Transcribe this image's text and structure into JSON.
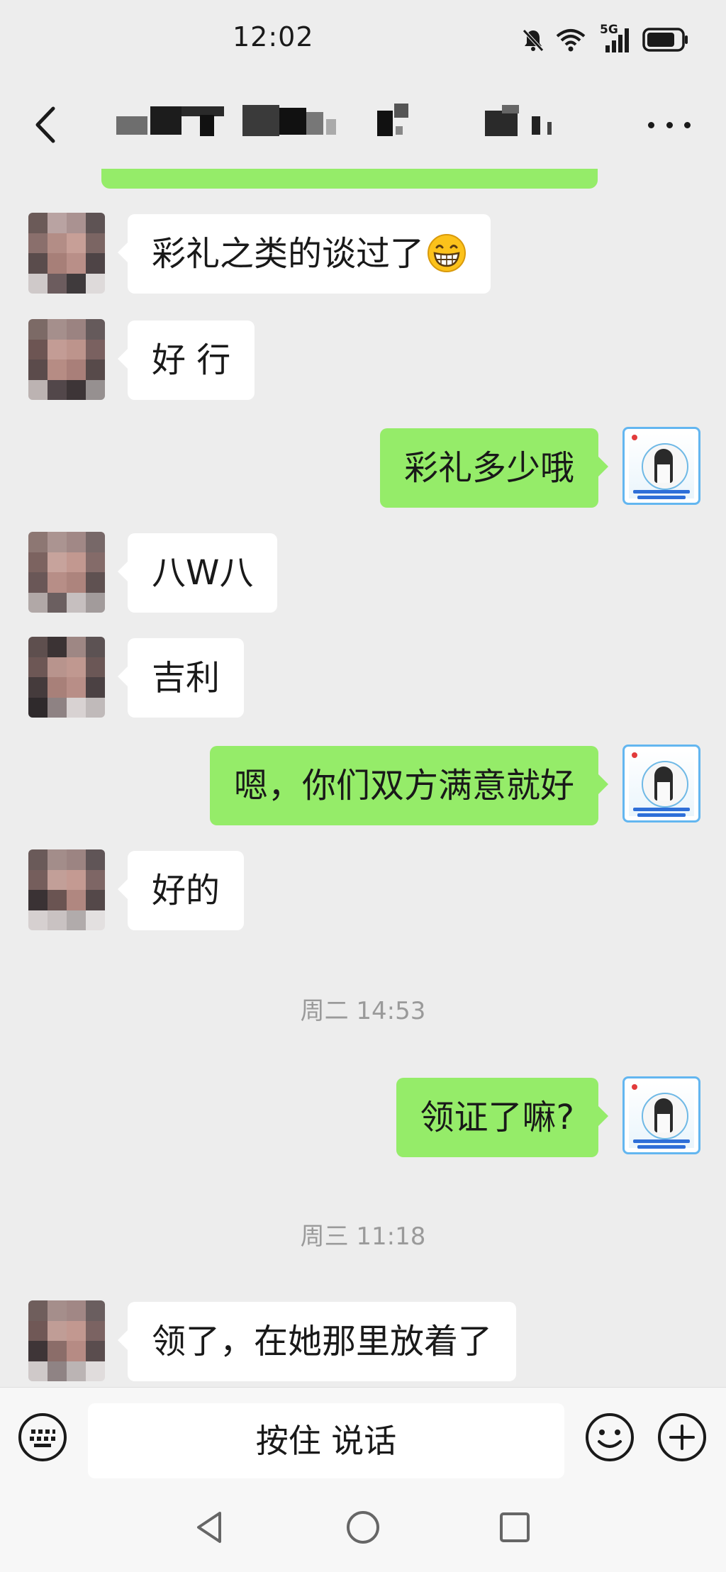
{
  "status_bar": {
    "time": "12:02",
    "network": "5G",
    "icons": [
      "mute-bell-icon",
      "wifi-icon",
      "signal-icon",
      "battery-icon"
    ]
  },
  "nav": {
    "back_icon": "chevron-left-icon",
    "title_redacted": true,
    "more_icon": "more-dots-icon"
  },
  "colors": {
    "background": "#ededed",
    "outgoing_bubble": "#95ec69",
    "incoming_bubble": "#ffffff",
    "timestamp_text": "#9a9a9a"
  },
  "messages": [
    {
      "side": "left",
      "text": "彩礼之类的谈过了",
      "emoji": "grinning-face-icon"
    },
    {
      "side": "left",
      "text": "好 行"
    },
    {
      "side": "right",
      "text": "彩礼多少哦"
    },
    {
      "side": "left",
      "text": "八W八"
    },
    {
      "side": "left",
      "text": "吉利"
    },
    {
      "side": "right",
      "text": "嗯，你们双方满意就好"
    },
    {
      "side": "left",
      "text": "好的"
    },
    {
      "side": "right",
      "text": "领证了嘛?"
    },
    {
      "side": "left",
      "text": "领了，在她那里放着了"
    }
  ],
  "timestamps": [
    "周二 14:53",
    "周三 11:18"
  ],
  "input_bar": {
    "keyboard_icon": "keyboard-icon",
    "voice_label": "按住 说话",
    "emoji_icon": "smiley-icon",
    "add_icon": "plus-circle-icon"
  },
  "system_nav": [
    "back-triangle-icon",
    "home-circle-icon",
    "recents-square-icon"
  ]
}
